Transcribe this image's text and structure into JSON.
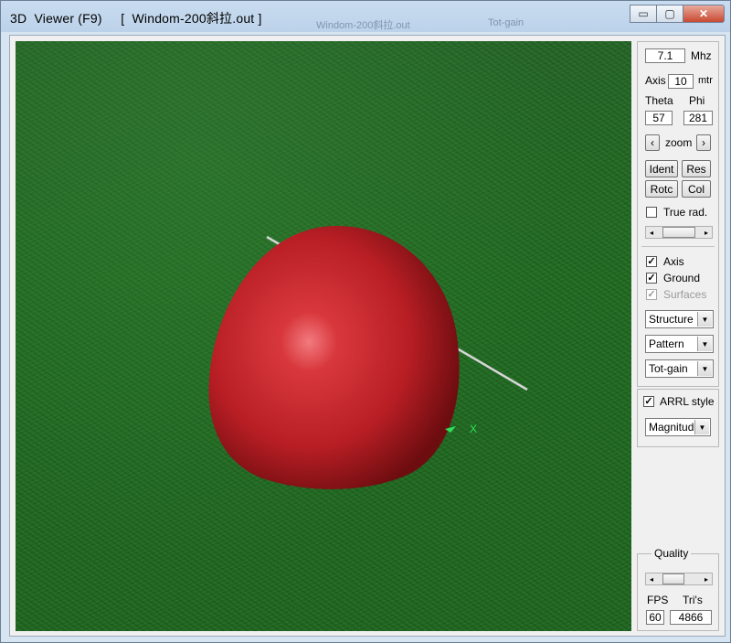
{
  "window": {
    "title": "3D  Viewer (F9)     [  Windom-200斜拉.out ]",
    "ghost_title_1": "Windom-200斜拉.out",
    "ghost_title_2": "Tot-gain",
    "controls": {
      "minimize": "▭",
      "maximize": "▢",
      "close": "✕"
    }
  },
  "panel": {
    "freq_value": "7.1",
    "freq_unit": "Mhz",
    "axis_label": "Axis",
    "axis_value": "10",
    "axis_unit": "mtr",
    "theta_label": "Theta",
    "phi_label": "Phi",
    "theta_value": "57",
    "phi_value": "281",
    "zoom_label": "zoom",
    "zoom_left": "‹",
    "zoom_right": "›",
    "buttons": {
      "ident": "Ident",
      "res": "Res",
      "rotc": "Rotc",
      "col": "Col"
    },
    "true_rad_label": "True rad.",
    "true_rad_checked": false,
    "axis_check_label": "Axis",
    "axis_checked": true,
    "ground_label": "Ground",
    "ground_checked": true,
    "surfaces_label": "Surfaces",
    "surfaces_checked": true,
    "dropdowns": {
      "structure": "Structure",
      "pattern": "Pattern",
      "totgain": "Tot-gain",
      "magnitude": "Magnitude"
    },
    "arrl_label": "ARRL style",
    "arrl_checked": true,
    "quality_label": "Quality",
    "fps_label": "FPS",
    "tris_label": "Tri's",
    "fps_value": "60",
    "tris_value": "4866"
  },
  "colors": {
    "sphere": "#c8242a",
    "ground": "#1d5a1f",
    "axis_marker": "#2ee05a"
  },
  "viewport": {
    "axis_x_label": "X"
  }
}
